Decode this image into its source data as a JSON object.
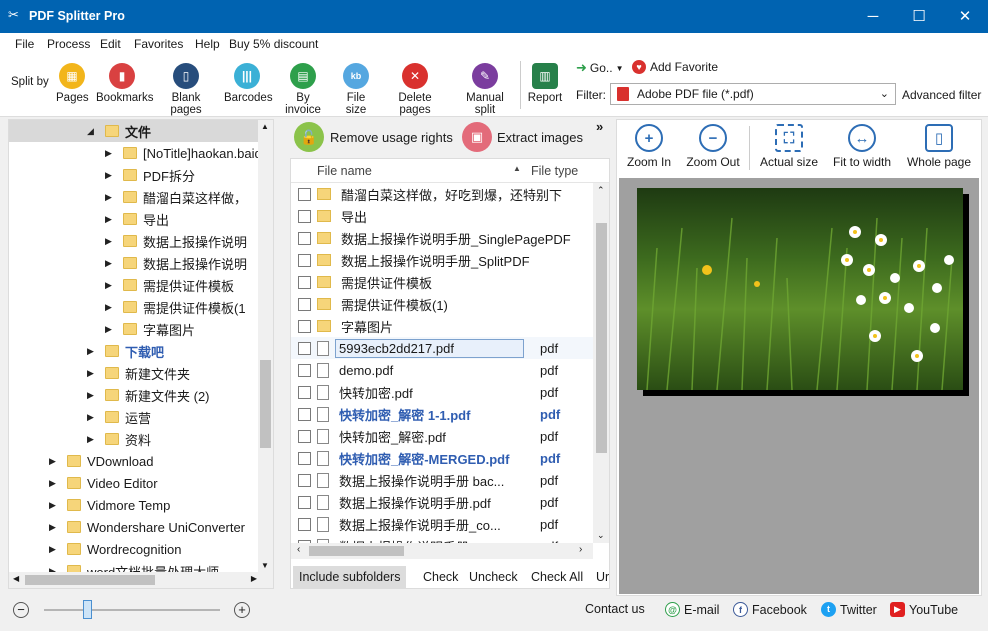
{
  "window": {
    "title": "PDF Splitter Pro",
    "min": "─",
    "max": "☐",
    "close": "✕"
  },
  "menu": [
    "File",
    "Process",
    "Edit",
    "Favorites",
    "Help",
    "Buy 5% discount"
  ],
  "toolbar": {
    "split_by": "Split by",
    "buttons": [
      {
        "label": "Pages",
        "color": "#f2b51b"
      },
      {
        "label": "Bookmarks",
        "color": "#d94141"
      },
      {
        "label": "Blank pages",
        "color": "#274d7c"
      },
      {
        "label": "Barcodes",
        "color": "#3bb0d6"
      },
      {
        "label": "By invoice",
        "color": "#2e9f4b"
      },
      {
        "label": "File size",
        "color": "#55a7e0"
      },
      {
        "label": "Delete pages",
        "color": "#d9312e"
      },
      {
        "label": "Manual split",
        "color": "#7b3d9e"
      },
      {
        "label": "Report",
        "color": "#27804a"
      }
    ],
    "go": "Go..",
    "add_favorite": "Add Favorite",
    "filter_label": "Filter:",
    "filter_value": "Adobe PDF file (*.pdf)",
    "advanced_filter": "Advanced filter"
  },
  "tree": {
    "items": [
      {
        "label": "文件",
        "level": 2,
        "expanded": true,
        "bold": true,
        "selected": true
      },
      {
        "label": "[NoTitle]haokan.baid",
        "level": 3
      },
      {
        "label": "PDF拆分",
        "level": 3
      },
      {
        "label": "醋溜白菜这样做，",
        "level": 3
      },
      {
        "label": "导出",
        "level": 3
      },
      {
        "label": "数据上报操作说明",
        "level": 3
      },
      {
        "label": "数据上报操作说明",
        "level": 3
      },
      {
        "label": "需提供证件模板",
        "level": 3
      },
      {
        "label": "需提供证件模板(1",
        "level": 3
      },
      {
        "label": "字幕图片",
        "level": 3
      },
      {
        "label": "下载吧",
        "level": 2,
        "bold": true
      },
      {
        "label": "新建文件夹",
        "level": 2
      },
      {
        "label": "新建文件夹 (2)",
        "level": 2
      },
      {
        "label": "运营",
        "level": 2
      },
      {
        "label": "资料",
        "level": 2
      },
      {
        "label": "VDownload",
        "level": 1
      },
      {
        "label": "Video Editor",
        "level": 1
      },
      {
        "label": "Vidmore Temp",
        "level": 1
      },
      {
        "label": "Wondershare UniConverter",
        "level": 1
      },
      {
        "label": "Wordrecognition",
        "level": 1
      },
      {
        "label": "word文档批量处理大师",
        "level": 1
      }
    ]
  },
  "actions": {
    "remove_rights": "Remove usage rights",
    "extract_images": "Extract images",
    "more": "»"
  },
  "files": {
    "col_name": "File name",
    "col_type": "File type",
    "rows": [
      {
        "name": "醋溜白菜这样做，好吃到爆，还特别下",
        "type": "",
        "folder": true
      },
      {
        "name": "导出",
        "type": "",
        "folder": true
      },
      {
        "name": "数据上报操作说明手册_SinglePagePDF",
        "type": "",
        "folder": true
      },
      {
        "name": "数据上报操作说明手册_SplitPDF",
        "type": "",
        "folder": true
      },
      {
        "name": "需提供证件模板",
        "type": "",
        "folder": true
      },
      {
        "name": "需提供证件模板(1)",
        "type": "",
        "folder": true
      },
      {
        "name": "字幕图片",
        "type": "",
        "folder": true
      },
      {
        "name": "5993ecb2dd217.pdf",
        "type": "pdf",
        "selected": true
      },
      {
        "name": "demo.pdf",
        "type": "pdf"
      },
      {
        "name": "快转加密.pdf",
        "type": "pdf"
      },
      {
        "name": "快转加密_解密 1-1.pdf",
        "type": "pdf",
        "bold": true
      },
      {
        "name": "快转加密_解密.pdf",
        "type": "pdf"
      },
      {
        "name": "快转加密_解密-MERGED.pdf",
        "type": "pdf",
        "bold": true
      },
      {
        "name": "数据上报操作说明手册 bac...",
        "type": "pdf"
      },
      {
        "name": "数据上报操作说明手册.pdf",
        "type": "pdf"
      },
      {
        "name": "数据上报操作说明手册_co...",
        "type": "pdf"
      },
      {
        "name": "数据上报操作说明手册_...",
        "type": "pdf"
      }
    ],
    "footer": [
      "Include subfolders",
      "Check",
      "Uncheck",
      "Check All",
      "Ur"
    ]
  },
  "viewer": {
    "buttons": [
      "Zoom In",
      "Zoom Out",
      "Actual size",
      "Fit to width",
      "Whole page"
    ]
  },
  "status": {
    "contact": "Contact us",
    "email": "E-mail",
    "facebook": "Facebook",
    "twitter": "Twitter",
    "youtube": "YouTube",
    "zoom_minus": "−",
    "zoom_plus": "+"
  }
}
